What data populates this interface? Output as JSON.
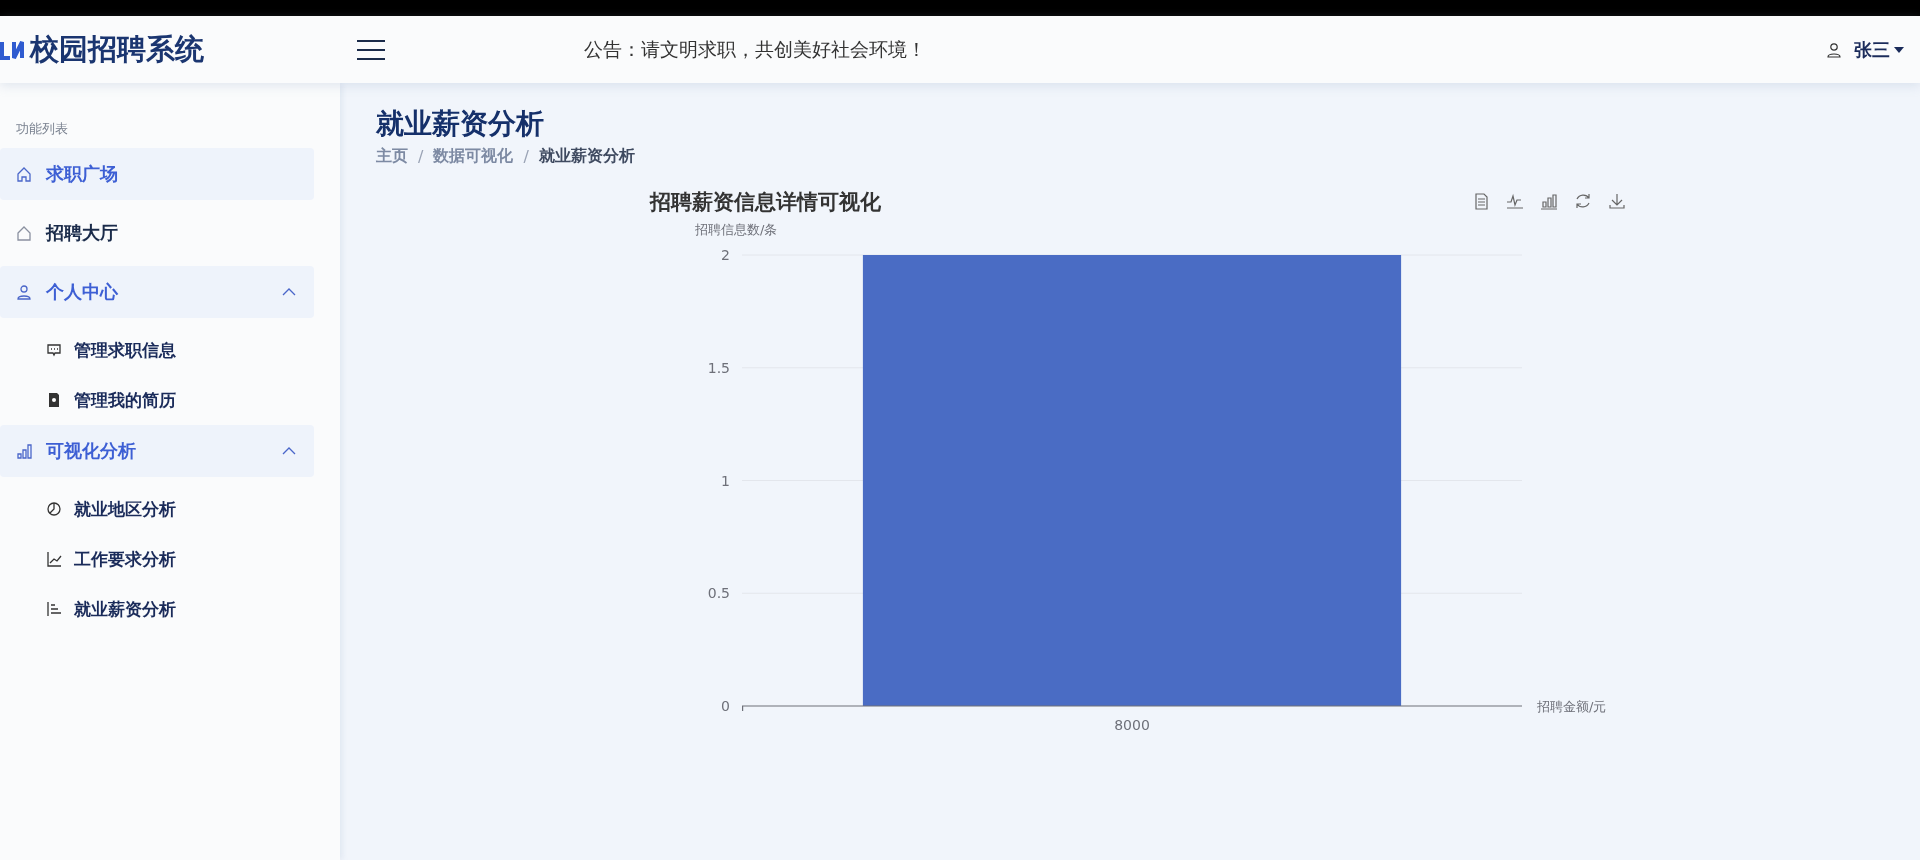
{
  "header": {
    "logo_text": "校园招聘系统",
    "notice": "公告：请文明求职，共创美好社会环境！",
    "user": "张三"
  },
  "sidebar": {
    "heading": "功能列表",
    "items": [
      {
        "label": "求职广场",
        "selected": true
      },
      {
        "label": "招聘大厅",
        "selected": false
      },
      {
        "label": "个人中心",
        "expanded": true,
        "children": [
          {
            "label": "管理求职信息",
            "selected": false
          },
          {
            "label": "管理我的简历",
            "selected": false
          }
        ]
      },
      {
        "label": "可视化分析",
        "expanded": true,
        "children": [
          {
            "label": "就业地区分析",
            "selected": false
          },
          {
            "label": "工作要求分析",
            "selected": false
          },
          {
            "label": "就业薪资分析",
            "selected": false
          }
        ]
      }
    ]
  },
  "page": {
    "title": "就业薪资分析",
    "breadcrumb_separator": "/",
    "breadcrumb": [
      {
        "label": "主页",
        "current": false
      },
      {
        "label": "数据可视化",
        "current": false
      },
      {
        "label": "就业薪资分析",
        "current": true
      }
    ]
  },
  "chart": {
    "chart_data": {
      "type": "bar",
      "title": "招聘薪资信息详情可视化",
      "xlabel": "招聘金额/元",
      "ylabel": "招聘信息数/条",
      "categories": [
        "8000"
      ],
      "series": [
        {
          "color": "#4a6cc4",
          "values": [
            2
          ]
        }
      ],
      "ylim": [
        0,
        2
      ],
      "yticks": [
        0,
        0.5,
        1,
        1.5,
        2
      ],
      "grid": true
    }
  }
}
